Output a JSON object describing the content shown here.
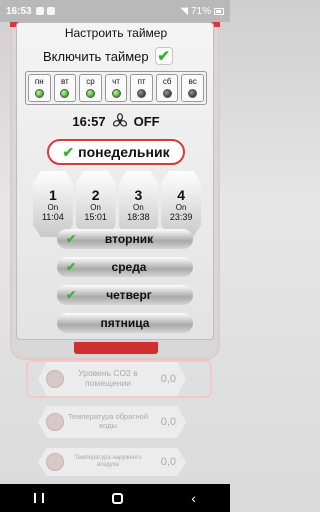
{
  "status": {
    "time": "16:53",
    "battery": "71%"
  },
  "dialog": {
    "title": "Настроить таймер",
    "enable_label": "Включить таймер",
    "enabled": true,
    "weekdays": [
      {
        "label": "пн",
        "active": true
      },
      {
        "label": "вт",
        "active": true
      },
      {
        "label": "ср",
        "active": true
      },
      {
        "label": "чт",
        "active": true
      },
      {
        "label": "пт",
        "active": false
      },
      {
        "label": "сб",
        "active": false
      },
      {
        "label": "вс",
        "active": false
      }
    ],
    "current_time": "16:57",
    "fan_state": "OFF",
    "selected_day": "понедельник",
    "slots": [
      {
        "num": "1",
        "state": "On",
        "time": "11:04"
      },
      {
        "num": "2",
        "state": "On",
        "time": "15:01"
      },
      {
        "num": "3",
        "state": "On",
        "time": "18:38"
      },
      {
        "num": "4",
        "state": "On",
        "time": "23:39"
      }
    ],
    "other_days": [
      {
        "label": "вторник",
        "checked": true
      },
      {
        "label": "среда",
        "checked": true
      },
      {
        "label": "четверг",
        "checked": true
      },
      {
        "label": "пятница",
        "checked": false
      }
    ]
  },
  "background_cards": [
    {
      "label": "Уровень CO2 в помещении",
      "value": "0,0"
    },
    {
      "label": "Температура обратной воды",
      "value": "0,0"
    },
    {
      "label": "Температура наружного воздуха",
      "value": "0,0"
    }
  ],
  "colors": {
    "accent_red": "#d73a3a",
    "check_green": "#3fb13b"
  }
}
